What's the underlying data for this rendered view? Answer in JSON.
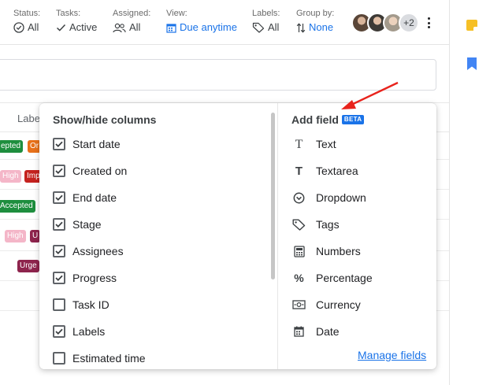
{
  "toolbar": {
    "filters": [
      {
        "label": "Status:",
        "value": "All",
        "icon": "check-circle-icon"
      },
      {
        "label": "Tasks:",
        "value": "Active",
        "icon": "check-icon"
      },
      {
        "label": "Assigned:",
        "value": "All",
        "icon": "people-icon"
      },
      {
        "label": "View:",
        "value": "Due anytime",
        "icon": "calendar-icon"
      },
      {
        "label": "Labels:",
        "value": "All",
        "icon": "label-icon"
      },
      {
        "label": "Group by:",
        "value": "None",
        "icon": "sort-icon"
      }
    ],
    "assignees_more": "+2"
  },
  "board": {
    "column_header_partial": "Labe",
    "tags": [
      "epted",
      "Or",
      "High",
      "Imp",
      "Accepted",
      "High",
      "U",
      "Urge"
    ]
  },
  "popup": {
    "columns_title": "Show/hide columns",
    "columns": [
      {
        "label": "Start date",
        "checked": true
      },
      {
        "label": "Created on",
        "checked": true
      },
      {
        "label": "End date",
        "checked": true
      },
      {
        "label": "Stage",
        "checked": true
      },
      {
        "label": "Assignees",
        "checked": true
      },
      {
        "label": "Progress",
        "checked": true
      },
      {
        "label": "Task ID",
        "checked": false
      },
      {
        "label": "Labels",
        "checked": true
      },
      {
        "label": "Estimated time",
        "checked": false
      }
    ],
    "add_field_title": "Add field",
    "beta_badge": "BETA",
    "field_types": [
      {
        "label": "Text",
        "icon": "text-icon"
      },
      {
        "label": "Textarea",
        "icon": "textarea-icon"
      },
      {
        "label": "Dropdown",
        "icon": "dropdown-icon"
      },
      {
        "label": "Tags",
        "icon": "tags-icon"
      },
      {
        "label": "Numbers",
        "icon": "numbers-icon"
      },
      {
        "label": "Percentage",
        "icon": "percentage-icon"
      },
      {
        "label": "Currency",
        "icon": "currency-icon"
      },
      {
        "label": "Date",
        "icon": "date-icon"
      }
    ],
    "manage_fields_link": "Manage fields"
  },
  "colors": {
    "accent": "#1a73e8",
    "annotation_arrow": "#e8231c",
    "tag_green": "#1e8e3e",
    "tag_orange": "#e8711a",
    "tag_pink": "#f4b6c8",
    "tag_red": "#c5221f",
    "tag_maroon": "#8e244d"
  }
}
